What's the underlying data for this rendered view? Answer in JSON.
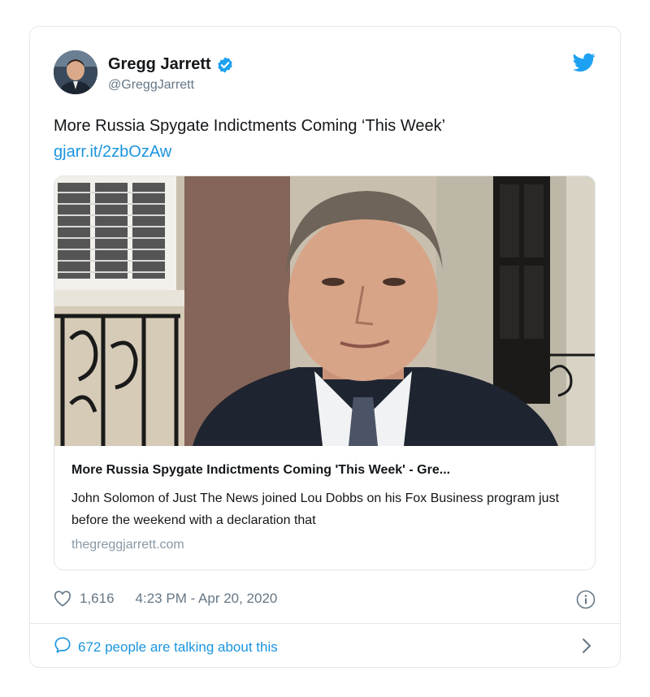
{
  "author": {
    "name": "Gregg Jarrett",
    "handle": "@GreggJarrett"
  },
  "tweet": {
    "text": "More Russia Spygate Indictments Coming ‘This Week’",
    "link": "gjarr.it/2zbOzAw"
  },
  "link_card": {
    "title": "More Russia Spygate Indictments Coming 'This Week' - Gre...",
    "description": "John Solomon of Just The News joined Lou Dobbs on his Fox Business program just before the weekend with a declaration that",
    "domain": "thegreggjarrett.com"
  },
  "stats": {
    "likes": "1,616",
    "timestamp": "4:23 PM - Apr 20, 2020"
  },
  "footer": {
    "talking": "672 people are talking about this"
  },
  "colors": {
    "accent": "#1b95e0",
    "secondary_text": "#657786",
    "border": "#e1e8ed"
  }
}
